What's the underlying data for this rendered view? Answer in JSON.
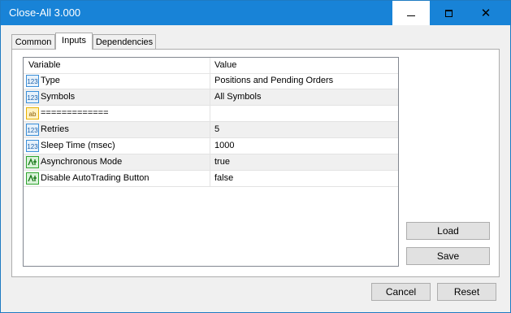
{
  "window": {
    "title": "Close-All 3.000"
  },
  "tabs": [
    {
      "label": "Common",
      "active": false
    },
    {
      "label": "Inputs",
      "active": true
    },
    {
      "label": "Dependencies",
      "active": false
    }
  ],
  "table": {
    "headers": {
      "variable": "Variable",
      "value": "Value"
    },
    "rows": [
      {
        "name": "Type",
        "value": "Positions and Pending Orders",
        "icon": "numeric-icon"
      },
      {
        "name": "Symbols",
        "value": "All Symbols",
        "icon": "numeric-icon"
      },
      {
        "name": "=============",
        "value": "",
        "icon": "string-icon"
      },
      {
        "name": "Retries",
        "value": "5",
        "icon": "numeric-icon"
      },
      {
        "name": "Sleep Time (msec)",
        "value": "1000",
        "icon": "numeric-icon"
      },
      {
        "name": "Asynchronous Mode",
        "value": "true",
        "icon": "boolean-icon"
      },
      {
        "name": "Disable AutoTrading Button",
        "value": "false",
        "icon": "boolean-icon"
      }
    ]
  },
  "buttons": {
    "load": "Load",
    "save": "Save",
    "cancel": "Cancel",
    "reset": "Reset"
  },
  "colors": {
    "titlebar": "#1883d7",
    "numeric_icon": "#3b8fd9",
    "string_icon": "#e8b100",
    "boolean_icon": "#2fa52f"
  }
}
